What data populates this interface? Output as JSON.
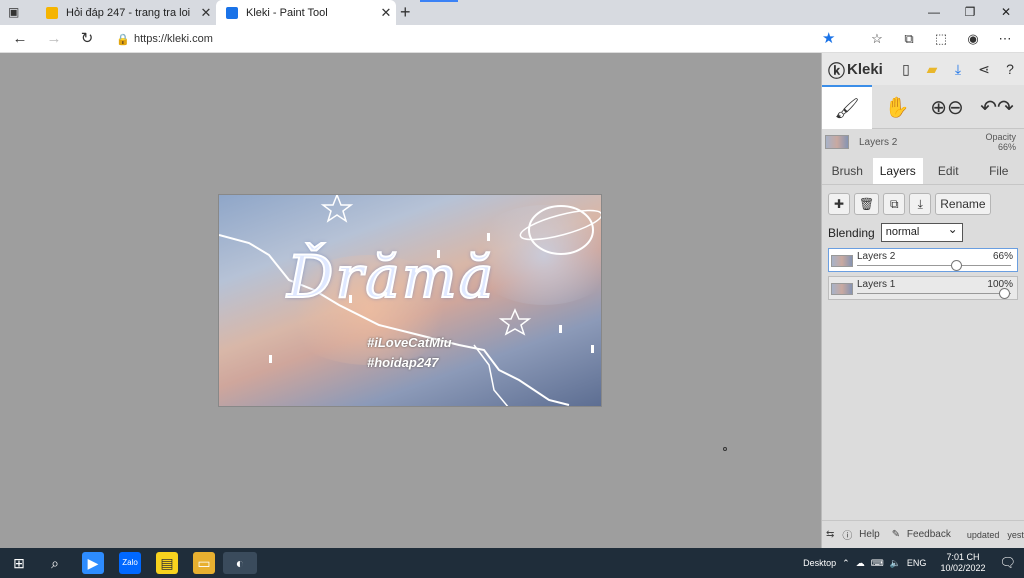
{
  "browser": {
    "tabs": [
      {
        "title": "Hỏi đáp 247 - trang tra loi",
        "favicon_color": "#f5b400",
        "active": false
      },
      {
        "title": "Kleki - Paint Tool",
        "favicon_color": "#1a73e8",
        "active": true
      }
    ],
    "url": "https://kleki.com",
    "accent": "#1a73e8"
  },
  "artwork": {
    "big_text": "Ďrămă",
    "tag1": "#iLoveCatMiu",
    "tag2": "#hoidap247"
  },
  "panel": {
    "brand": "Kleki",
    "current_layer": "Layers 2",
    "opacity_label": "Opacity",
    "opacity_value": "66%",
    "tabs": [
      "Brush",
      "Layers",
      "Edit",
      "File"
    ],
    "active_tab": "Layers",
    "rename_label": "Rename",
    "blending_label": "Blending",
    "blending_value": "normal",
    "layers": [
      {
        "name": "Layers 2",
        "opacity": "66%",
        "opacity_fraction": 0.66,
        "selected": true
      },
      {
        "name": "Layers 1",
        "opacity": "100%",
        "opacity_fraction": 1.0,
        "selected": false
      }
    ],
    "help_label": "Help",
    "feedback_label": "Feedback",
    "updated_line1": "updated",
    "updated_line2": "yesterday"
  },
  "taskbar": {
    "desktop_label": "Desktop",
    "lang": "ENG",
    "time": "7:01 CH",
    "date": "10/02/2022"
  }
}
